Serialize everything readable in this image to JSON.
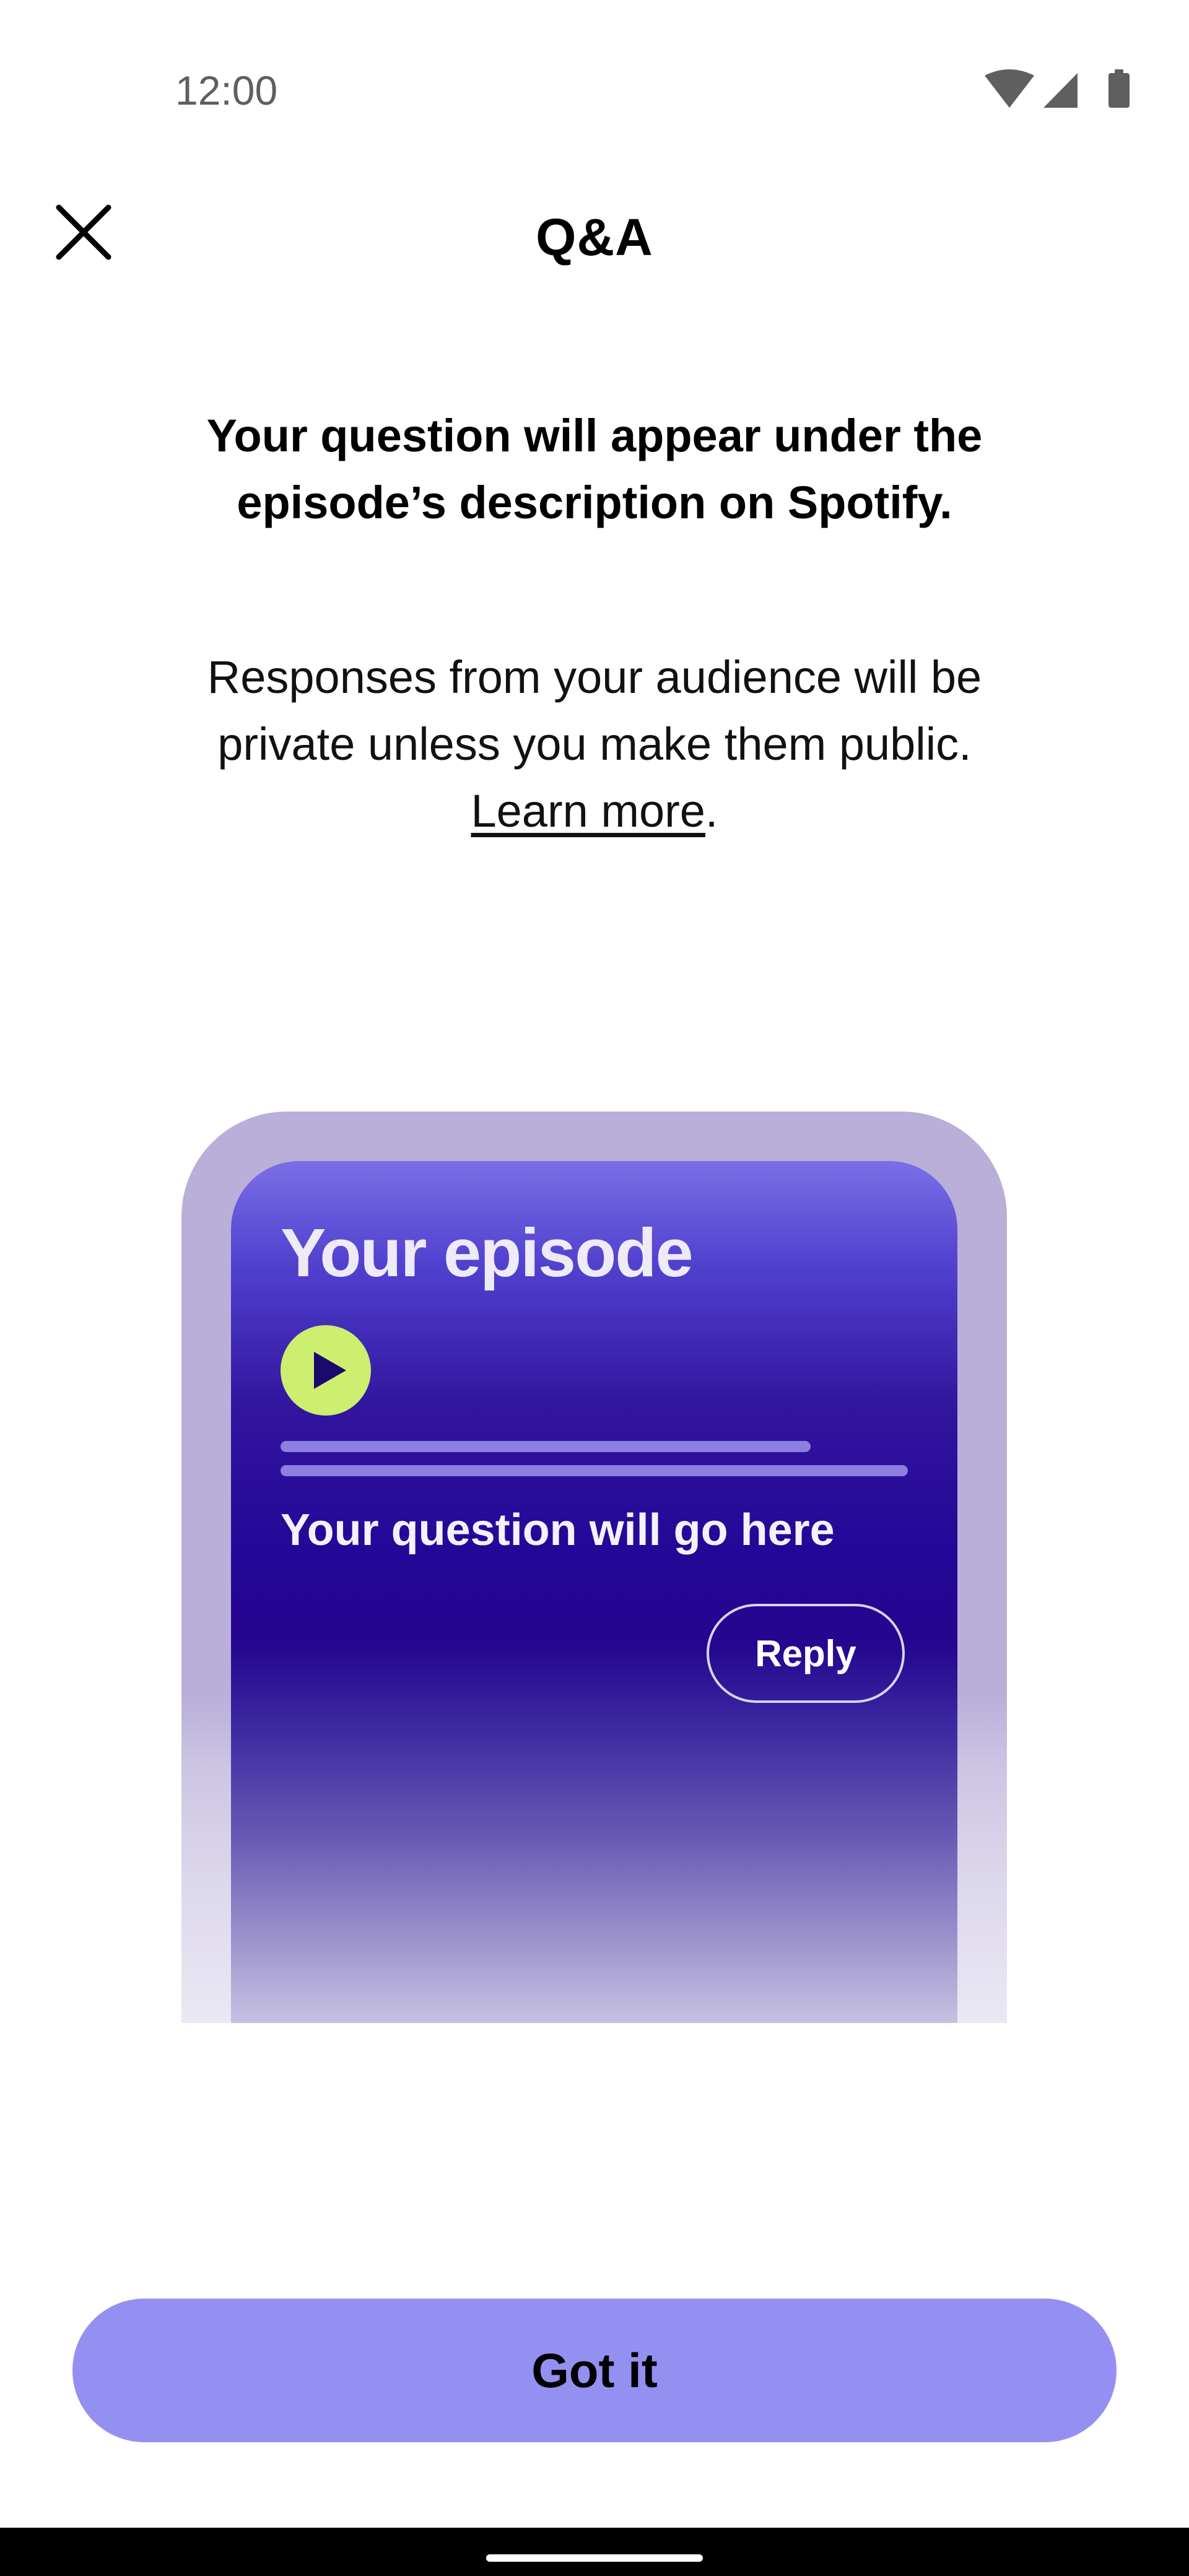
{
  "status_bar": {
    "time": "12:00",
    "icons": [
      "wifi-icon",
      "cellular-signal-icon",
      "battery-icon"
    ]
  },
  "header": {
    "close_icon": "close-icon",
    "title": "Q&A"
  },
  "content": {
    "headline": "Your question will appear under the episode’s description on Spotify.",
    "body_text": "Responses from your audience will be private unless you make them public.",
    "learn_more_label": "Learn more",
    "learn_more_suffix": "."
  },
  "illustration": {
    "title": "Your episode",
    "play_icon": "play-icon",
    "question_text": "Your question will go here",
    "reply_label": "Reply"
  },
  "actions": {
    "got_it_label": "Got it"
  },
  "colors": {
    "button_bg": "#9490f2",
    "play_button": "#cdee6e",
    "phone_purple": "#230797",
    "outer_lavender": "#b9afd9"
  }
}
